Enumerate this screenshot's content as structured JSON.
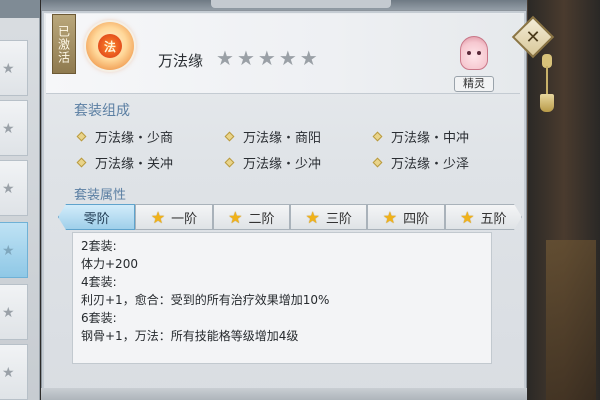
{
  "header": {
    "activated_tag": "已激活",
    "set_name": "万法缘",
    "set_icon_glyph": "法",
    "stars": [
      false,
      false,
      false,
      false,
      false
    ],
    "sprite_label": "精灵"
  },
  "sections": {
    "compose_title": "套装组成",
    "attr_title": "套装属性"
  },
  "items": [
    "万法缘・少商",
    "万法缘・商阳",
    "万法缘・中冲",
    "万法缘・关冲",
    "万法缘・少冲",
    "万法缘・少泽"
  ],
  "tabs": [
    {
      "label": "零阶",
      "active": true,
      "star": false
    },
    {
      "label": "一阶",
      "active": false,
      "star": true
    },
    {
      "label": "二阶",
      "active": false,
      "star": true
    },
    {
      "label": "三阶",
      "active": false,
      "star": true
    },
    {
      "label": "四阶",
      "active": false,
      "star": true
    },
    {
      "label": "五阶",
      "active": false,
      "star": true
    }
  ],
  "description": [
    "2套装:",
    "体力+200",
    "4套装:",
    "利刃+1，愈合：受到的所有治疗效果增加10%",
    "6套装:",
    "钢骨+1，万法：所有技能格等级增加4级"
  ],
  "close_label": "✕",
  "colors": {
    "accent": "#5b7fa3",
    "star_gold": "#f0b21a",
    "active_tab": "#9fcfea"
  }
}
